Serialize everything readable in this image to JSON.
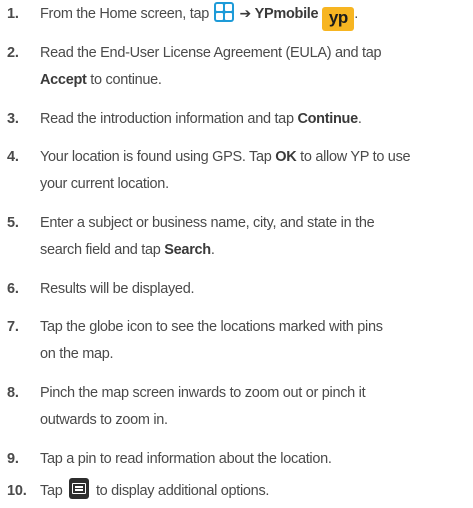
{
  "steps": [
    {
      "number": "1.",
      "parts": {
        "before": "From the Home screen, tap ",
        "arrow": "➔",
        "app_name": "YPmobile",
        "logo_text": "yp",
        "after": "."
      }
    },
    {
      "number": "2.",
      "line1": "Read the End-User License Agreement (EULA) and tap",
      "bold": "Accept",
      "after": " to continue."
    },
    {
      "number": "3.",
      "before": "Read the introduction information and tap ",
      "bold": "Continue",
      "after": "."
    },
    {
      "number": "4.",
      "before": "Your location is found using GPS. Tap ",
      "bold": "OK",
      "after": " to allow YP to use",
      "line2": "your current location."
    },
    {
      "number": "5.",
      "line1": "Enter a subject or business name, city, and state in the",
      "before2": "search field and tap ",
      "bold": "Search",
      "after": "."
    },
    {
      "number": "6.",
      "line1": "Results will be displayed."
    },
    {
      "number": "7.",
      "line1": "Tap the globe icon to see the locations marked with pins",
      "line2": "on the map."
    },
    {
      "number": "8.",
      "line1": "Pinch the map screen inwards to zoom out or pinch it",
      "line2": "outwards to zoom in."
    },
    {
      "number": "9.",
      "line1": "Tap a pin to read information about the location."
    },
    {
      "number": "10.",
      "before": "Tap ",
      "after": " to display additional options."
    }
  ],
  "icons": {
    "apps": "apps-grid-icon",
    "yp": "ypmobile-app-icon",
    "menu": "menu-icon"
  },
  "colors": {
    "text": "#4a4a4a",
    "apps_icon_bg": "#1e9bd8",
    "yp_icon_bg": "#f7b521",
    "menu_icon_bg": "#2d2d2d"
  }
}
